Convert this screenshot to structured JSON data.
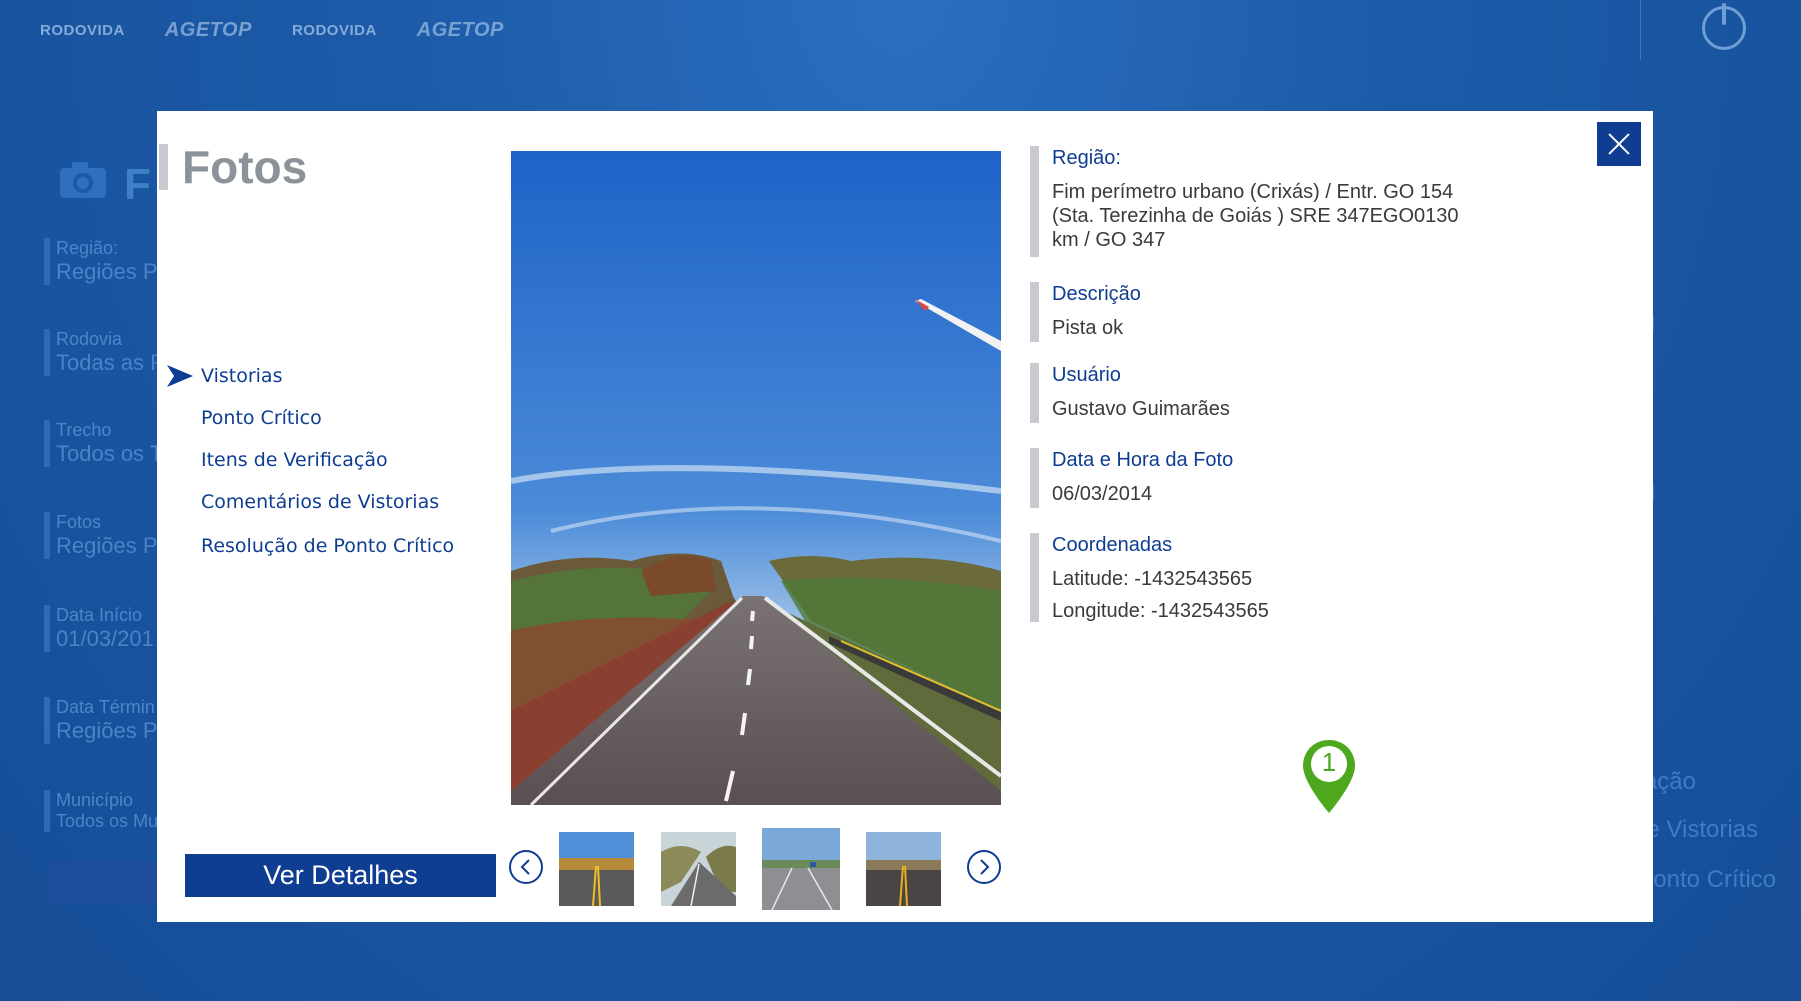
{
  "background": {
    "logos": [
      "RODOVIDA",
      "AGETOP",
      "RODOVIDA",
      "AGETOP"
    ],
    "heading": "F",
    "fields": [
      {
        "label": "Região:",
        "value": "Regiões Pa"
      },
      {
        "label": "Rodovia",
        "value": "Todas as R"
      },
      {
        "label": "Trecho",
        "value": "Todos os T"
      },
      {
        "label": "Fotos",
        "value": "Regiões Pa"
      },
      {
        "label": "Data Início",
        "value": "01/03/201"
      },
      {
        "label": "Data Términ",
        "value": "Regiões Pa"
      },
      {
        "label": "Município",
        "value": "Todos os Mu"
      }
    ],
    "right_texts": [
      "um",
      "um",
      "ação",
      "e Vistorias",
      "onto Crítico"
    ]
  },
  "modal": {
    "title": "Fotos",
    "nav": [
      {
        "label": "Vistorias",
        "active": true
      },
      {
        "label": "Ponto Crítico",
        "active": false
      },
      {
        "label": "Itens de Verificação",
        "active": false
      },
      {
        "label": "Comentários de Vistorias",
        "active": false
      },
      {
        "label": "Resolução de Ponto Crítico",
        "active": false
      }
    ],
    "ver_detalhes_label": "Ver Detalhes",
    "info": {
      "regiao_label": "Região:",
      "regiao_value_lines": [
        "Fim perímetro urbano (Crixás) / Entr. GO 154",
        "(Sta. Terezinha de Goiás ) SRE 347EGO0130",
        "km / GO 347"
      ],
      "descricao_label": "Descrição",
      "descricao_value": "Pista ok",
      "usuario_label": "Usuário",
      "usuario_value": "Gustavo Guimarães",
      "data_label": "Data e Hora da Foto",
      "data_value": "06/03/2014",
      "coord_label": "Coordenadas",
      "latitude": "Latitude: -1432543565",
      "longitude": "Longitude: -1432543565"
    },
    "pin_number": "1"
  },
  "colors": {
    "brand_blue": "#0e3d92",
    "title_gray": "#8c929a",
    "accent_bar": "#c7cbd0",
    "pin_green": "#4ea81e",
    "background_blue": "#1a58a6"
  },
  "icons": [
    "close-icon",
    "arrow-right-icon",
    "chevron-left-icon",
    "chevron-right-icon",
    "map-pin-icon",
    "power-icon",
    "camera-icon"
  ]
}
